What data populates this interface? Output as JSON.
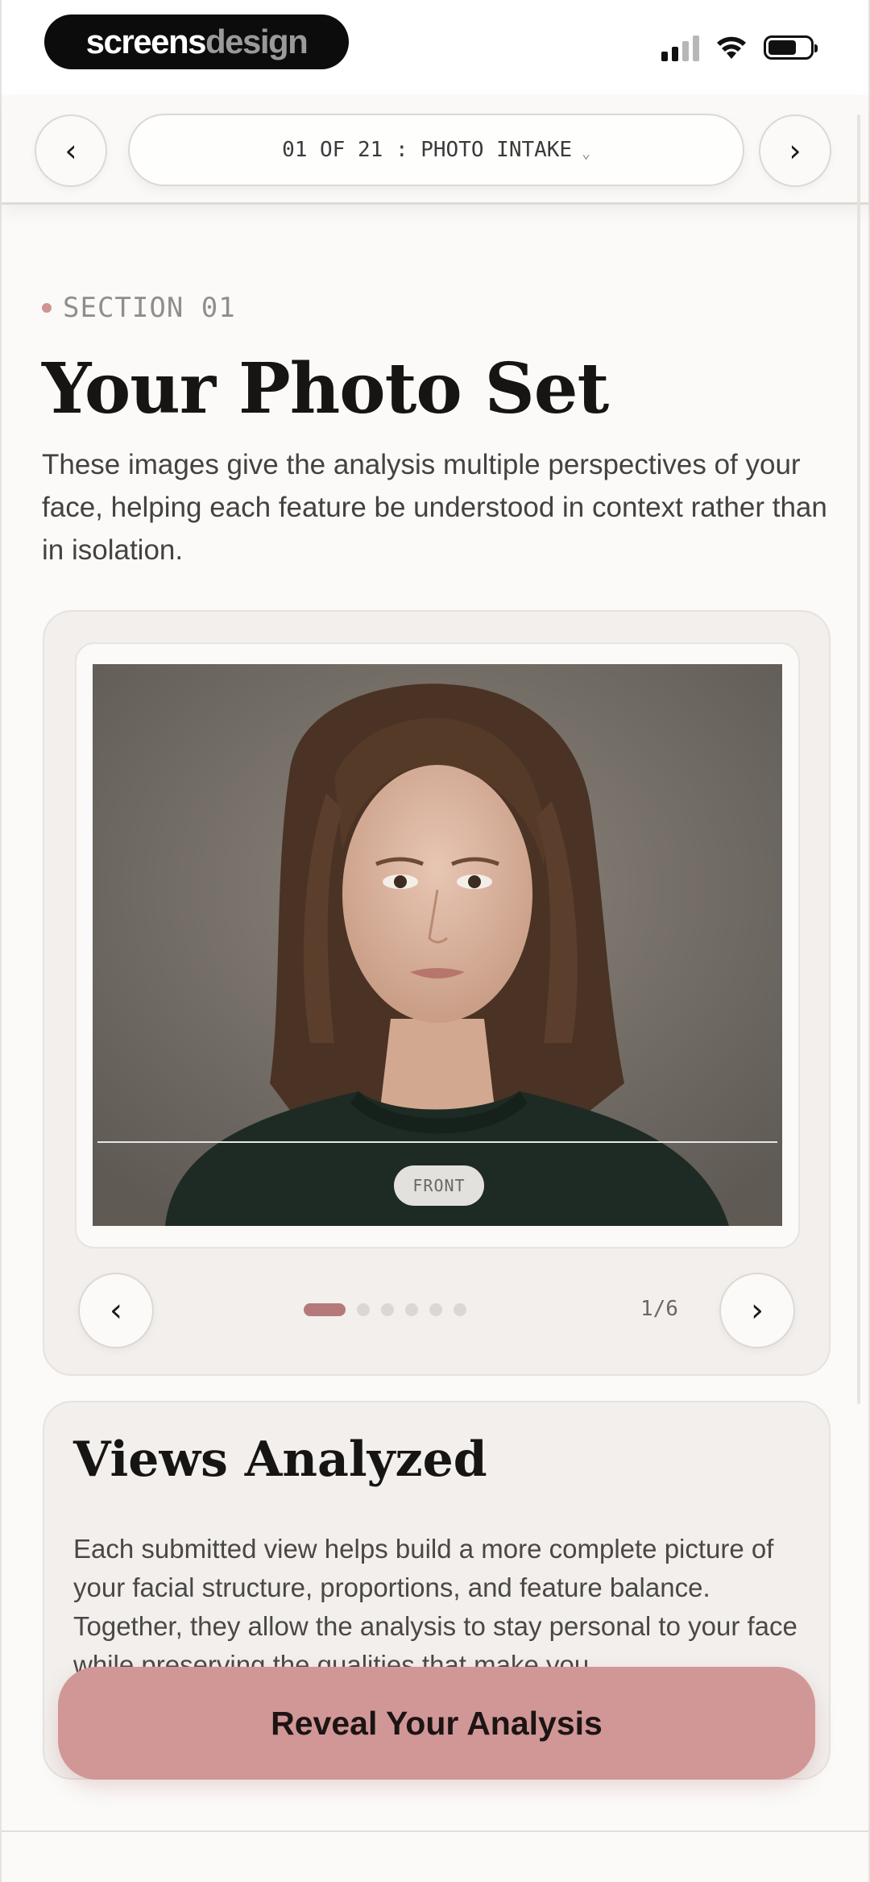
{
  "status_bar": {
    "brand_part1": "screens",
    "brand_part2": "design"
  },
  "nav": {
    "prev_icon": "‹",
    "next_icon": "›",
    "step_label": "01 OF 21 : PHOTO INTAKE",
    "dropdown_icon": "⌄"
  },
  "section": {
    "label": "SECTION 01",
    "title": "Your Photo Set",
    "intro": "These images give the analysis multiple perspectives of your face, helping each feature be understood in context rather than in isolation."
  },
  "carousel": {
    "view_label": "FRONT",
    "counter": "1/6",
    "total_slides": 6,
    "active_slide": 1,
    "prev_icon": "‹",
    "next_icon": "›"
  },
  "views": {
    "title": "Views Analyzed",
    "body": "Each submitted view helps build a more complete picture of your facial structure, proportions, and feature balance. Together, they allow the analysis to stay personal to your face while preserving the qualities that make you"
  },
  "cta": {
    "label": "Reveal Your Analysis",
    "color": "#d19797"
  },
  "colors": {
    "accent": "#cf9393",
    "background": "#fbfaf8",
    "card": "#f2efec"
  }
}
